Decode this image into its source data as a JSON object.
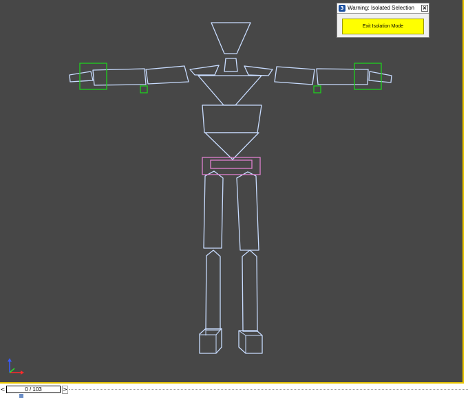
{
  "dialog": {
    "title": "Warning: Isolated Selection",
    "app_icon": "3ds-max-logo-icon",
    "close_label": "×",
    "exit_button_label": "Exit Isolation Mode",
    "exit_button_color": "#ffff00"
  },
  "viewport": {
    "background_color": "#474747",
    "border_color": "#e8c400",
    "wire_color": "#c8dcff",
    "ik_helper_color": "#1ed01e",
    "pelvis_color": "#e080d0"
  },
  "time_slider": {
    "frame_label": "0 / 103",
    "prev_label": "<",
    "next_label": ">"
  },
  "axis_gizmo": {
    "icon": "axis-tripod-icon"
  }
}
